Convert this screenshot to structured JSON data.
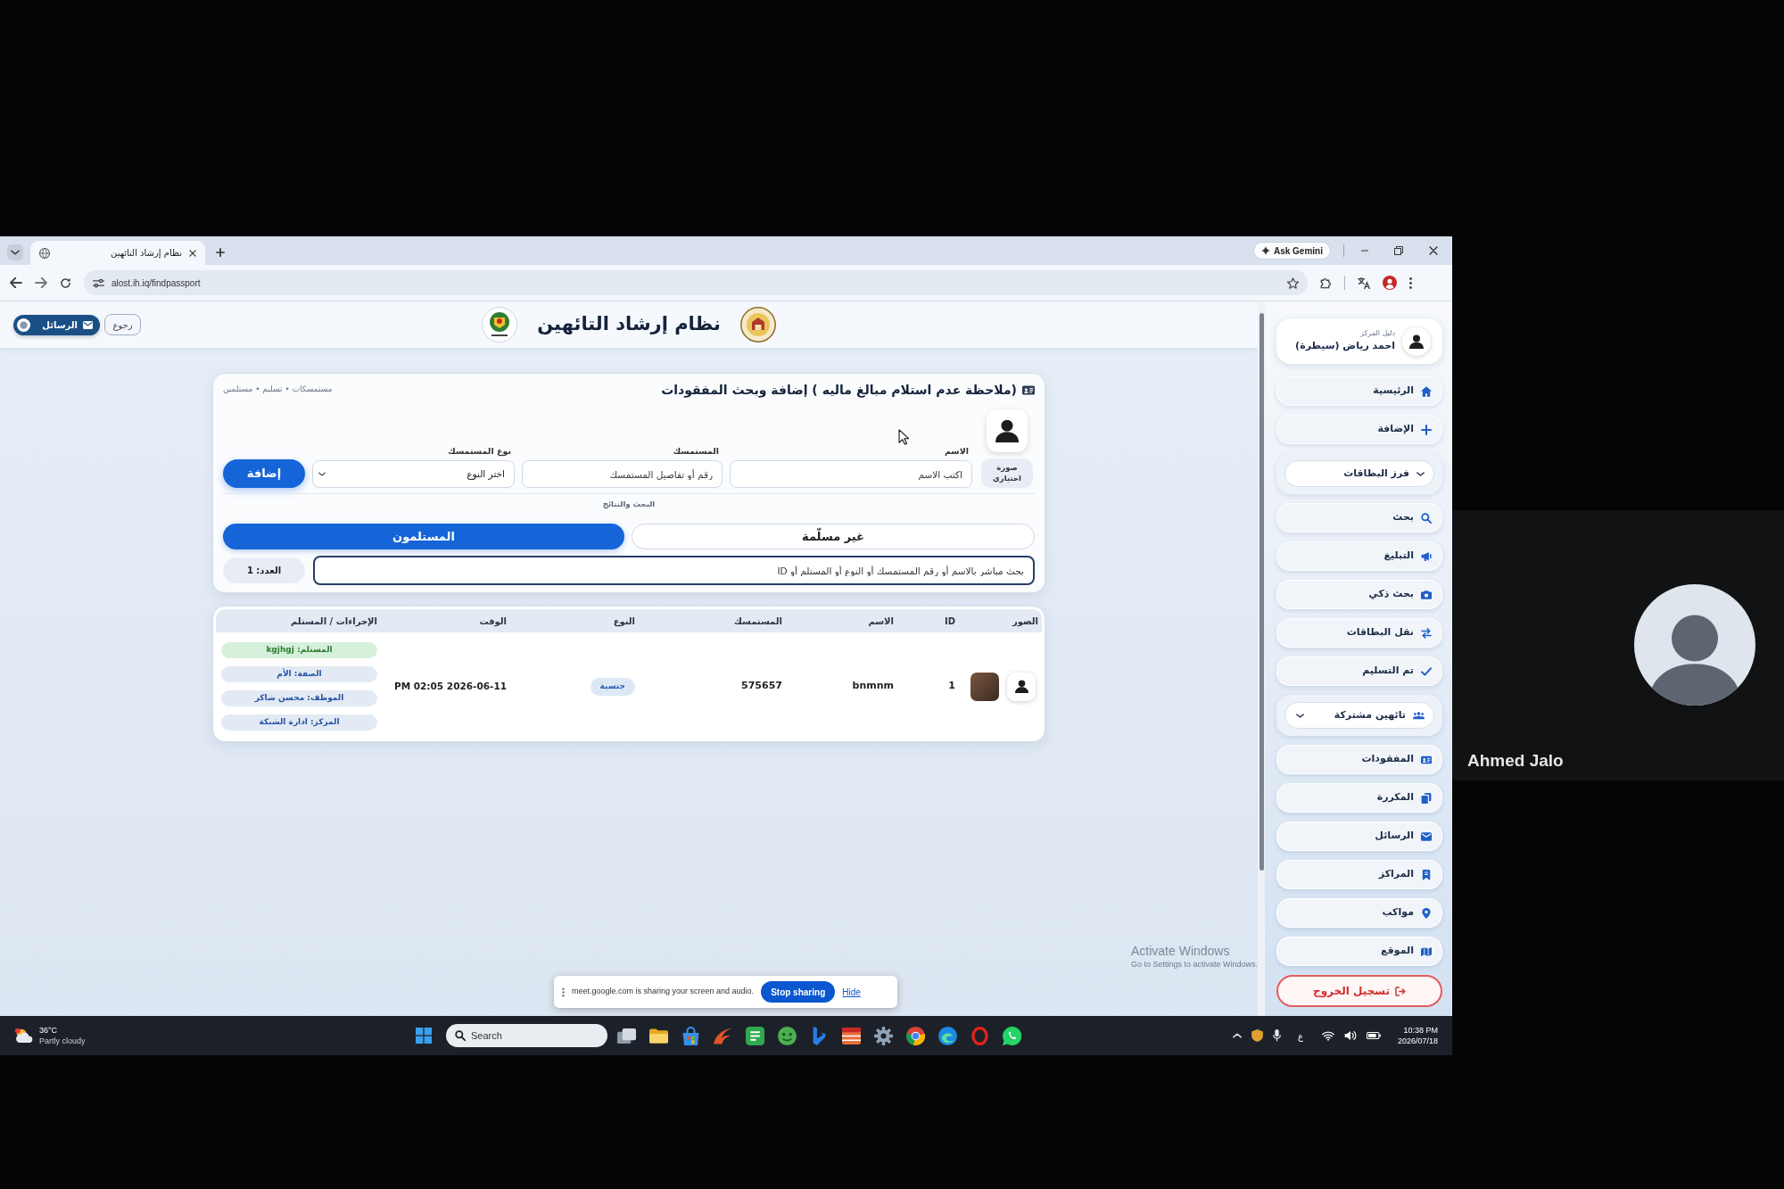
{
  "browser": {
    "tab": {
      "title": "نظام إرشاد التائهين"
    },
    "gemini_button": "Ask Gemini",
    "url": "alost.ih.iq/findpassport"
  },
  "header": {
    "messages_button": {
      "label": "الرسائل"
    },
    "back_button": "رجوع",
    "title": "نظام إرشاد التائهين"
  },
  "form_card": {
    "title": "(ملاحظة عدم استلام مبالغ ماليه ) إضافة وبحث المفقودات",
    "breadcrumb": "مستمسكات • تسليم • مستلمين",
    "photo_label": "صورة اختياري",
    "fields": [
      {
        "kind": "text",
        "label": "الاسم",
        "placeholder": "اكتب الاسم"
      },
      {
        "kind": "text",
        "label": "المستمسك",
        "placeholder": "رقم أو تفاصيل المستمسك"
      },
      {
        "kind": "select",
        "label": "نوع المستمسك",
        "value": "اختر النوع"
      }
    ],
    "add_button": "إضافة",
    "section_label": "البحث والنتائج",
    "tabs": [
      {
        "label": "غير مسلّمة",
        "selected": false
      },
      {
        "label": "المستلمون",
        "selected": true
      }
    ],
    "search": {
      "placeholder": "بحث مباشر بالاسم أو رقم المستمسك أو النوع أو المستلم أو ID"
    },
    "count": "العدد: 1"
  },
  "results_table": {
    "columns": [
      "الصور",
      "ID",
      "الاسم",
      "المستمسك",
      "النوع",
      "الوقت",
      "الإجراءات / المستلم"
    ],
    "rows": [
      {
        "id": "1",
        "name": "bnmnm",
        "document": "575657",
        "type": "جنسية",
        "time": "PM 02:05 2026-06-11",
        "details": [
          {
            "kind": "recipient",
            "text": "المستلم: kgjhgj"
          },
          {
            "kind": "info",
            "text": "الصفة: الأم"
          },
          {
            "kind": "info",
            "text": "الموظف: محسن شاكر"
          },
          {
            "kind": "info",
            "text": "المركز: ادارة الشبكة"
          }
        ]
      }
    ]
  },
  "sidebar": {
    "user": {
      "role": "دليل المركز",
      "name": "احمد رياض (سيطرة)"
    },
    "items": [
      {
        "kind": "link",
        "label": "الرئيسية"
      },
      {
        "kind": "link",
        "label": "الإضافة"
      },
      {
        "kind": "group",
        "label": "فرز البطاقات",
        "expanded": false
      },
      {
        "kind": "link",
        "label": "بحث"
      },
      {
        "kind": "link",
        "label": "التبليغ"
      },
      {
        "kind": "link",
        "label": "بحث ذكي"
      },
      {
        "kind": "link",
        "label": "نقل البطاقات"
      },
      {
        "kind": "link",
        "label": "تم التسليم"
      },
      {
        "kind": "group",
        "label": "تائهين مشتركة",
        "expanded": false
      },
      {
        "kind": "link",
        "label": "المفقودات"
      },
      {
        "kind": "link",
        "label": "المكررة"
      },
      {
        "kind": "link",
        "label": "الرسائل"
      },
      {
        "kind": "link",
        "label": "المراكز"
      },
      {
        "kind": "link",
        "label": "مواكب"
      },
      {
        "kind": "link",
        "label": "الموقع"
      },
      {
        "kind": "logout",
        "label": "تسجيل الخروج"
      }
    ]
  },
  "share_bar": {
    "message": "meet.google.com is sharing your screen and audio.",
    "stop_button": "Stop sharing",
    "hide_link": "Hide"
  },
  "windows_watermark": {
    "title": "Activate Windows",
    "hint": "Go to Settings to activate Windows."
  },
  "taskbar": {
    "weather": {
      "temperature": "36°C",
      "condition": "Partly cloudy"
    },
    "search_placeholder": "Search",
    "input_language": "ع",
    "clock": {
      "time": "10:38 PM",
      "date": "2026/07/18"
    }
  },
  "participant": {
    "name": "Ahmed Jalo"
  }
}
